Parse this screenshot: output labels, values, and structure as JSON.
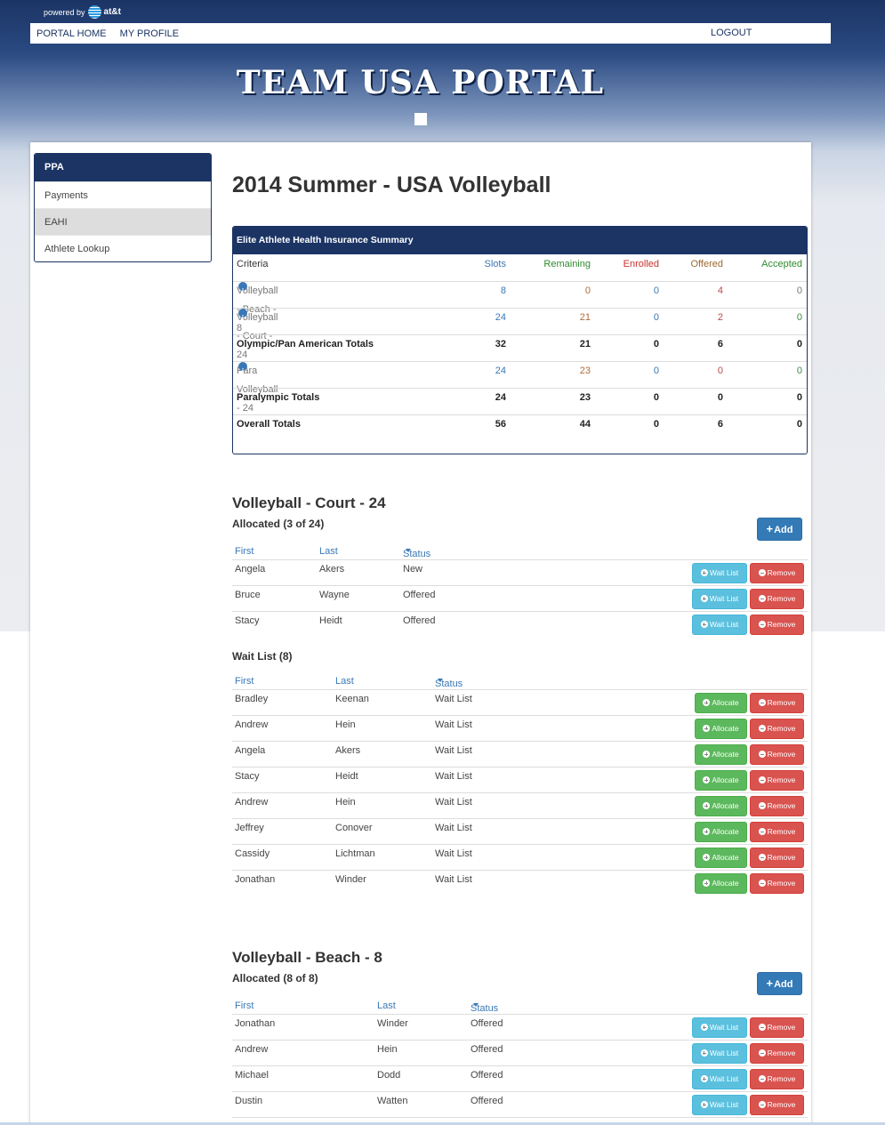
{
  "header": {
    "powered_by": "powered by",
    "brand": "at&t",
    "nav": [
      "PORTAL HOME",
      "MY PROFILE"
    ],
    "logout": "LOGOUT",
    "portal_title": "TEAM USA PORTAL"
  },
  "sidebar": {
    "title": "PPA",
    "items": [
      {
        "label": "Payments"
      },
      {
        "label": "EAHI",
        "active": true
      },
      {
        "label": "Athlete Lookup"
      }
    ]
  },
  "page_title": "2014 Summer - USA Volleyball",
  "summary": {
    "title": "Elite Athlete Health Insurance Summary",
    "columns": [
      "Criteria",
      "Slots",
      "Remaining",
      "Enrolled",
      "Offered",
      "Accepted"
    ],
    "rows": [
      {
        "criteria": "Volleyball - Beach - 8",
        "slots": "8",
        "remaining": "0",
        "enrolled": "0",
        "offered": "4",
        "accepted": "0"
      },
      {
        "criteria": "Volleyball - Court - 24",
        "slots": "24",
        "remaining": "21",
        "enrolled": "0",
        "offered": "2",
        "accepted": "0"
      },
      {
        "criteria": "Olympic/Pan American Totals",
        "slots": "32",
        "remaining": "21",
        "enrolled": "0",
        "offered": "6",
        "accepted": "0"
      },
      {
        "criteria": "Para Volleyball - 24",
        "slots": "24",
        "remaining": "23",
        "enrolled": "0",
        "offered": "0",
        "accepted": "0"
      },
      {
        "criteria": "Paralympic Totals",
        "slots": "24",
        "remaining": "23",
        "enrolled": "0",
        "offered": "0",
        "accepted": "0"
      },
      {
        "criteria": "Overall Totals",
        "slots": "56",
        "remaining": "44",
        "enrolled": "0",
        "offered": "6",
        "accepted": "0"
      }
    ]
  },
  "court": {
    "title": "Volleyball - Court - 24",
    "allocated_title": "Allocated (3 of 24)",
    "add_label": "Add",
    "columns": [
      "First",
      "Last",
      "Status"
    ],
    "allocated": [
      {
        "first": "Angela",
        "last": "Akers",
        "status": "New"
      },
      {
        "first": "Bruce",
        "last": "Wayne",
        "status": "Offered"
      },
      {
        "first": "Stacy",
        "last": "Heidt",
        "status": "Offered"
      }
    ],
    "waitlist_title": "Wait List (8)",
    "waitlist": [
      {
        "first": "Bradley",
        "last": "Keenan",
        "status": "Wait List"
      },
      {
        "first": "Andrew",
        "last": "Hein",
        "status": "Wait List"
      },
      {
        "first": "Angela",
        "last": "Akers",
        "status": "Wait List"
      },
      {
        "first": "Stacy",
        "last": "Heidt",
        "status": "Wait List"
      },
      {
        "first": "Andrew",
        "last": "Hein",
        "status": "Wait List"
      },
      {
        "first": "Jeffrey",
        "last": "Conover",
        "status": "Wait List"
      },
      {
        "first": "Cassidy",
        "last": "Lichtman",
        "status": "Wait List"
      },
      {
        "first": "Jonathan",
        "last": "Winder",
        "status": "Wait List"
      }
    ]
  },
  "beach": {
    "title": "Volleyball - Beach - 8",
    "allocated_title": "Allocated (8 of 8)",
    "add_label": "Add",
    "columns": [
      "First",
      "Last",
      "Status"
    ],
    "allocated": [
      {
        "first": "Jonathan",
        "last": "Winder",
        "status": "Offered"
      },
      {
        "first": "Andrew",
        "last": "Hein",
        "status": "Offered"
      },
      {
        "first": "Michael",
        "last": "Dodd",
        "status": "Offered"
      },
      {
        "first": "Dustin",
        "last": "Watten",
        "status": "Offered"
      }
    ]
  },
  "buttons": {
    "wait_list": "Wait List",
    "remove": "Remove",
    "allocate": "Allocate"
  }
}
